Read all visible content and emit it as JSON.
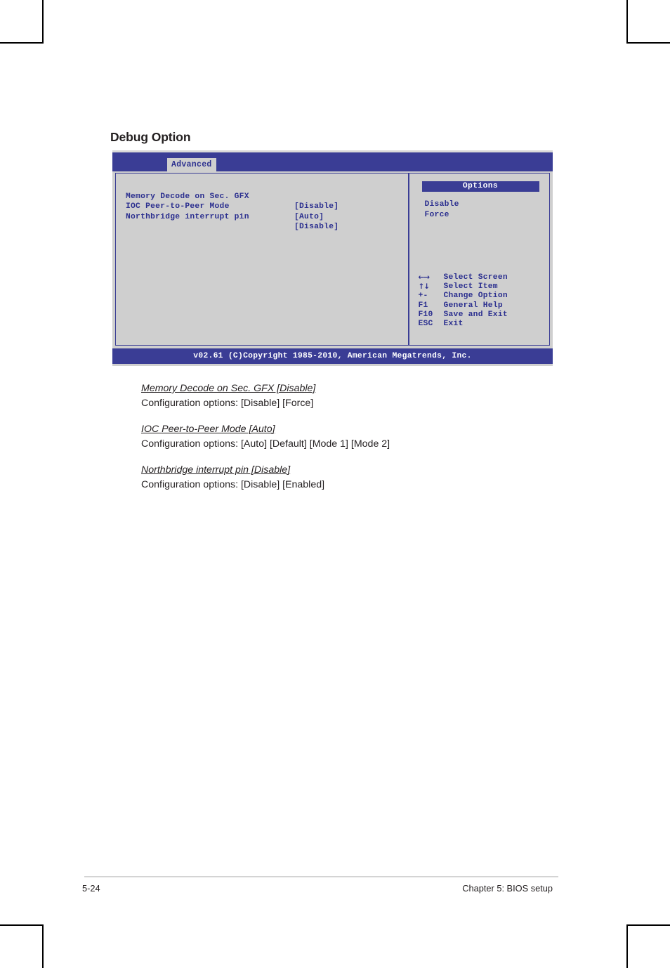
{
  "page": {
    "section_heading": "Debug Option",
    "footer_left": "5-24",
    "footer_right": "Chapter 5: BIOS setup"
  },
  "colors": {
    "bios_blue": "#3a3d95",
    "bios_gray": "#cfcfcf",
    "bios_text_blue": "#2b2f8f",
    "bios_white": "#ffffff",
    "page_text": "#231f20"
  },
  "bios": {
    "tab_label": "Advanced",
    "items": [
      {
        "label": "Memory Decode on Sec. GFX",
        "value": "[Disable]"
      },
      {
        "label": "IOC Peer-to-Peer Mode",
        "value": "[Auto]"
      },
      {
        "label": "Northbridge interrupt pin",
        "value": "[Disable]"
      }
    ],
    "options_panel": {
      "title": "Options",
      "options": [
        "Disable",
        "Force"
      ]
    },
    "key_hints": [
      {
        "key": "←→",
        "desc": "Select Screen",
        "arrow": true
      },
      {
        "key": "↑↓",
        "desc": "Select Item",
        "arrow": true
      },
      {
        "key": "+-",
        "desc": "Change Option",
        "arrow": false
      },
      {
        "key": "F1",
        "desc": "General Help",
        "arrow": false
      },
      {
        "key": "F10",
        "desc": "Save and Exit",
        "arrow": false
      },
      {
        "key": "ESC",
        "desc": "Exit",
        "arrow": false
      }
    ],
    "footer": "v02.61 (C)Copyright 1985-2010, American Megatrends, Inc."
  },
  "descriptions": [
    {
      "title": "Memory Decode on Sec. GFX [Disable]",
      "body": "Configuration options: [Disable] [Force]"
    },
    {
      "title": "IOC Peer-to-Peer Mode [Auto]",
      "body": "Configuration options: [Auto] [Default] [Mode 1] [Mode 2]"
    },
    {
      "title": "Northbridge interrupt pin [Disable]",
      "body": "Configuration options: [Disable] [Enabled]"
    }
  ]
}
